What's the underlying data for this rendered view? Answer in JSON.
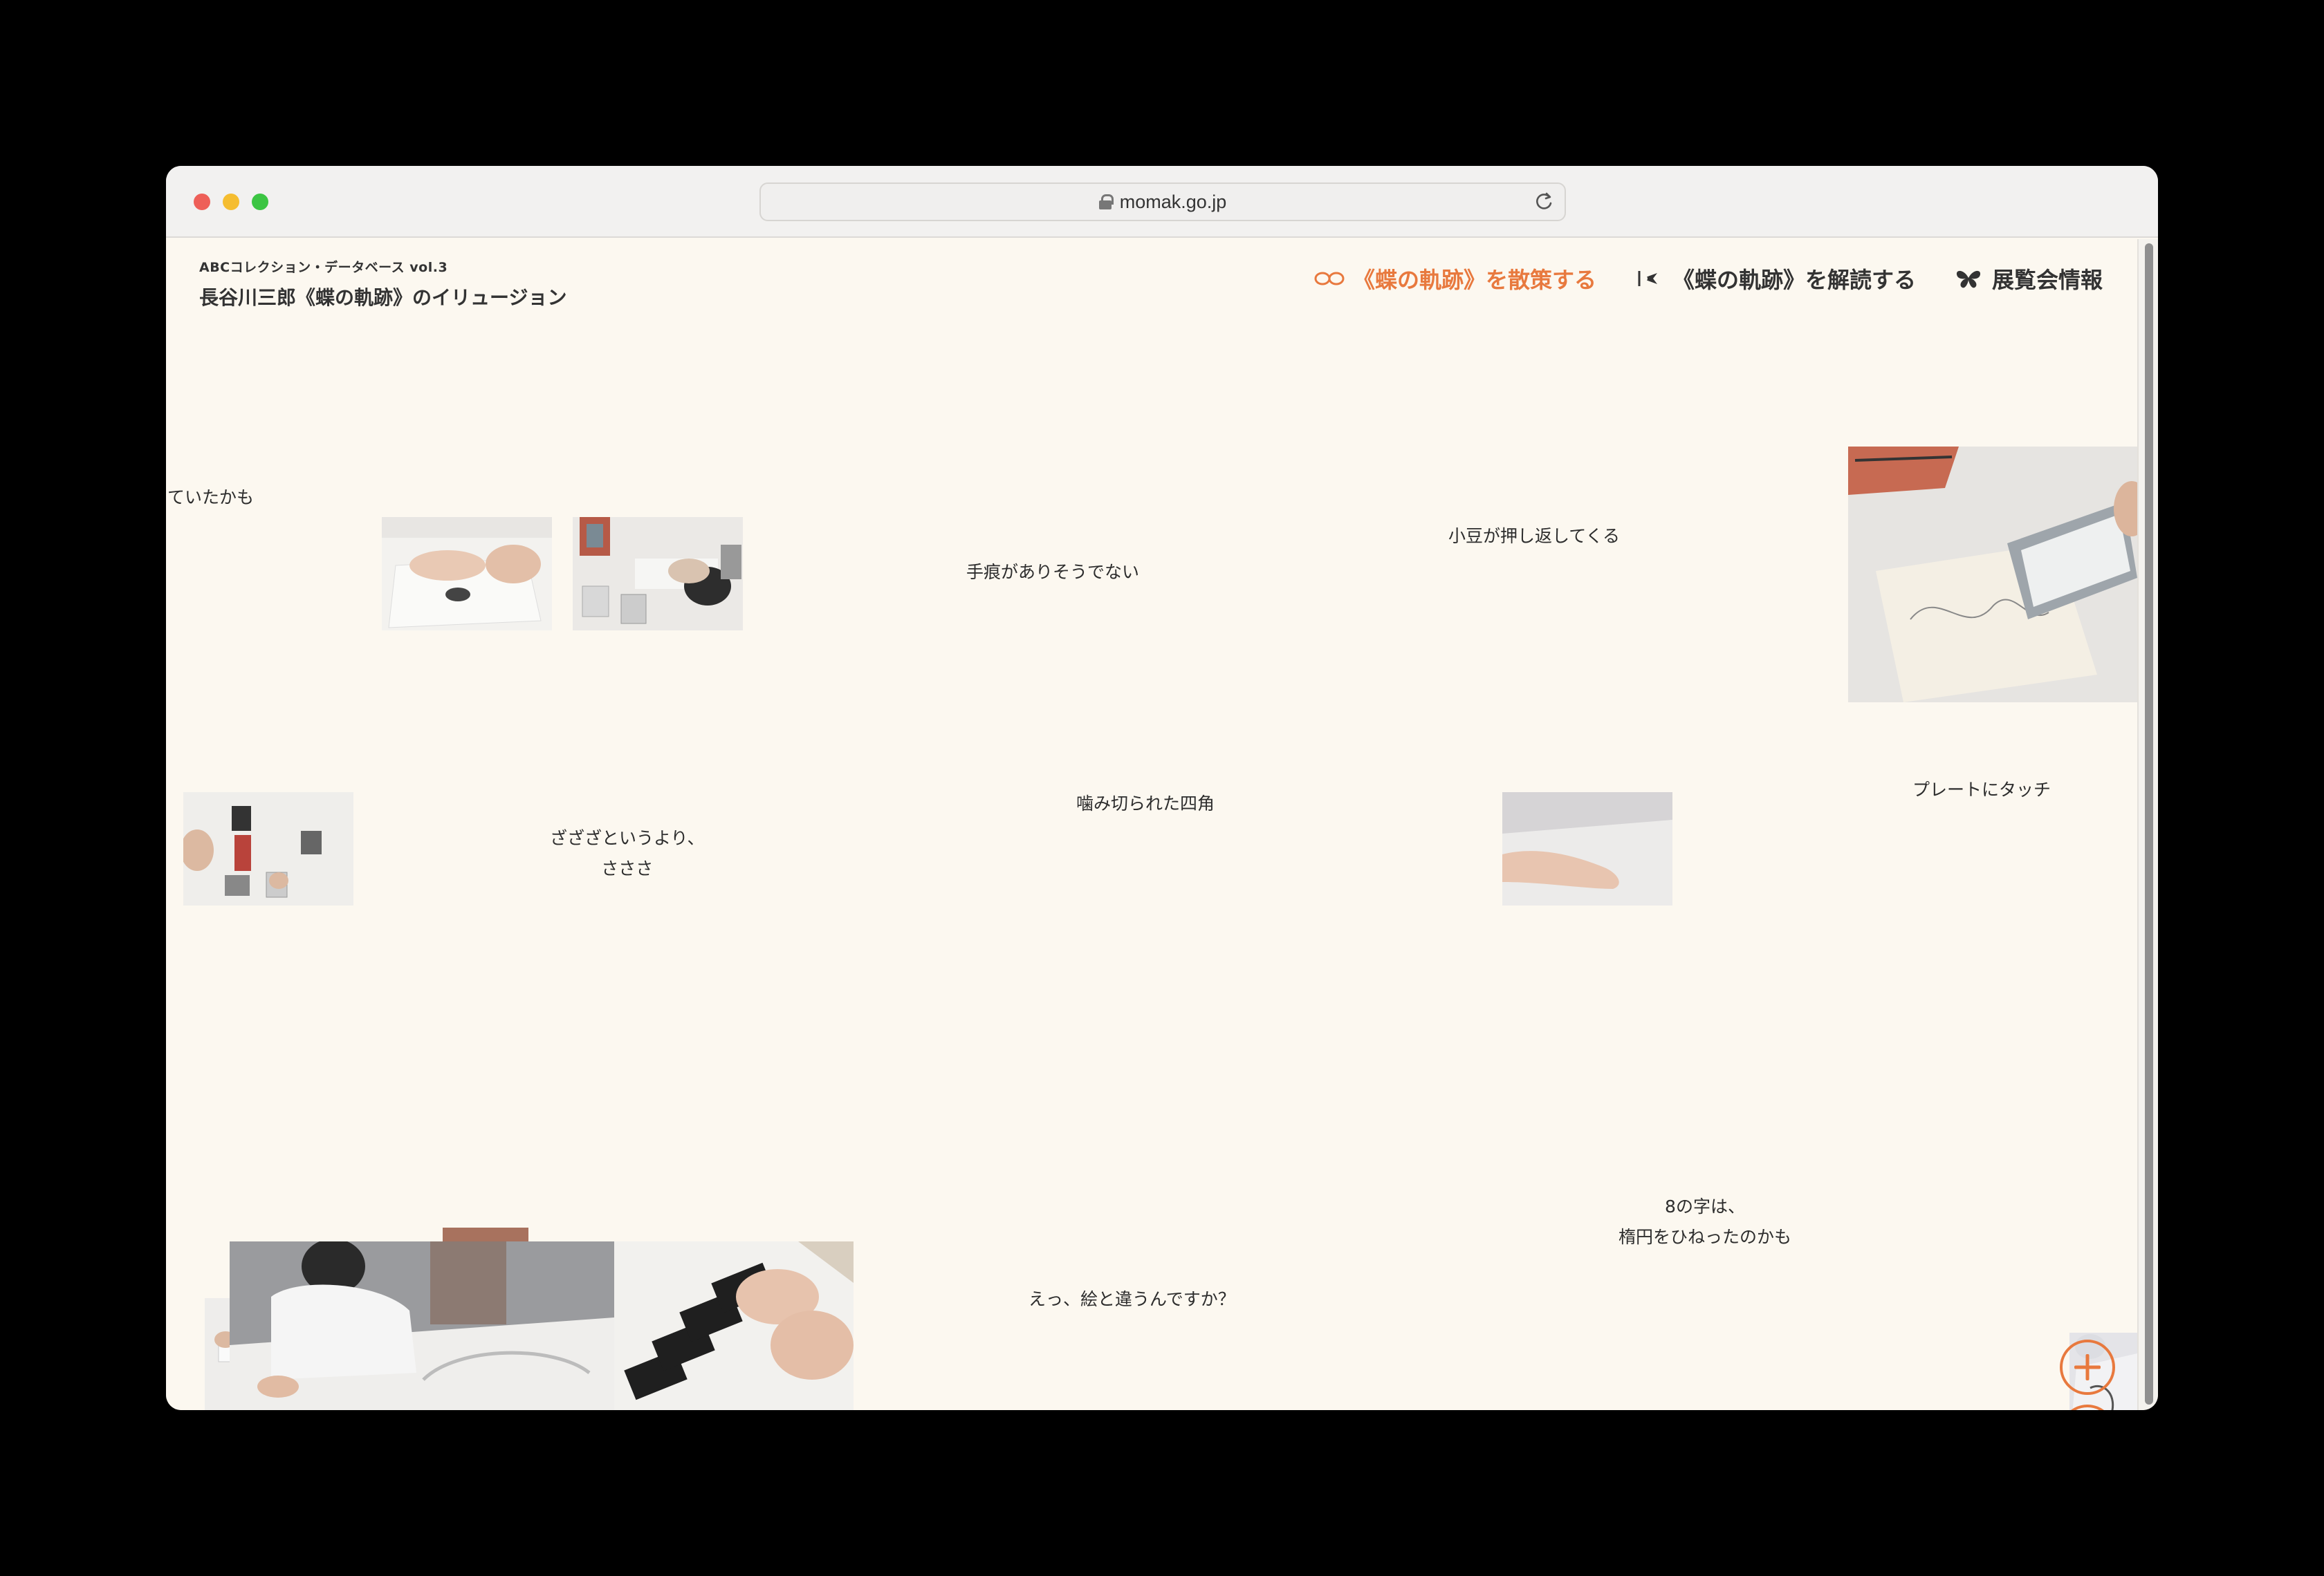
{
  "browser": {
    "url": "momak.go.jp"
  },
  "site": {
    "subtitle": "ABCコレクション・データベース vol.3",
    "title": "長谷川三郎《蝶の軌跡》のイリュージョン"
  },
  "nav": {
    "items": [
      {
        "label": "《蝶の軌跡》を散策する",
        "icon": "infinity-loop-icon",
        "active": true
      },
      {
        "label": "《蝶の軌跡》を解読する",
        "icon": "eye-scan-icon",
        "active": false
      },
      {
        "label": "展覧会情報",
        "icon": "butterfly-icon",
        "active": false
      }
    ]
  },
  "words": {
    "w1": "ていたかも",
    "w2": "手痕がありそうでない",
    "w3": "小豆が押し返してくる",
    "w4": "噛み切られた四角",
    "w5_line1": "ざざざというより、",
    "w5_line2": "さささ",
    "w6": "プレートにタッチ",
    "w7_line1": "8の字は、",
    "w7_line2": "楕円をひねったのかも",
    "w8": "えっ、絵と違うんですか？"
  },
  "colors": {
    "accent": "#e8793e",
    "background": "#fcf8f0",
    "text": "#333333"
  }
}
